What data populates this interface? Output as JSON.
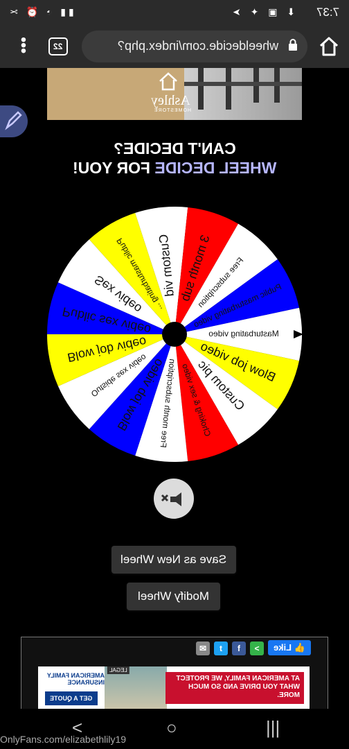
{
  "status_bar": {
    "time": "7:37",
    "icons_right": "⬇ ▣ ✦ ➤",
    "icons_left": "▮▮ ◔ ⏰ ✂"
  },
  "browser": {
    "url": "wheeldecide.com/index.php?",
    "tab_count": "22",
    "icons": [
      "home-icon",
      "lock-icon",
      "tab-switcher-icon",
      "more-menu-icon"
    ]
  },
  "ad_top": {
    "brand": "Ashley",
    "sub": "HOMESTORE"
  },
  "heading": {
    "line1": "CAN'T DECIDE?",
    "line2_a": "WHEEL DECIDE",
    "line2_b": " FOR YOU!"
  },
  "wheel": {
    "slices": [
      {
        "label": "Masturbating video",
        "color": "#ffffff"
      },
      {
        "label": "Blow job video",
        "color": "#ffff00"
      },
      {
        "label": "Custom pic",
        "color": "#ffffff"
      },
      {
        "label": "Choking & sex video",
        "color": "#ff0000"
      },
      {
        "label": "Free month subscription",
        "color": "#ffffff"
      },
      {
        "label": "Blow job video",
        "color": "#0000ff"
      },
      {
        "label": "Outside sex video",
        "color": "#ffffff"
      },
      {
        "label": "Blow job video",
        "color": "#ffff00"
      },
      {
        "label": "Public sex video",
        "color": "#0000ff"
      },
      {
        "label": "Sex video",
        "color": "#ffffff"
      },
      {
        "label": "Public masturbating ...",
        "color": "#ffff00"
      },
      {
        "label": "Custom vid",
        "color": "#ffffff"
      },
      {
        "label": "3 month sub",
        "color": "#ff0000"
      },
      {
        "label": "Free subscription",
        "color": "#ffffff"
      },
      {
        "label": "Public masturbating video",
        "color": "#0000ff"
      }
    ]
  },
  "buttons": {
    "save": "Save as New Wheel",
    "modify": "Modify Wheel"
  },
  "ad_bottom": {
    "like": "Like",
    "message": "AT AMERICAN FAMILY, WE PROTECT WHAT YOU DRIVE AND SO MUCH MORE.",
    "brand": "AMERICAN FAMILY INSURANCE",
    "cta": "GET A QUOTE",
    "legal": "LEGAL"
  },
  "nav": {
    "back": "<",
    "home": "○",
    "recents": "|||"
  },
  "watermark": "OnlyFans.com/elizabethlily19"
}
